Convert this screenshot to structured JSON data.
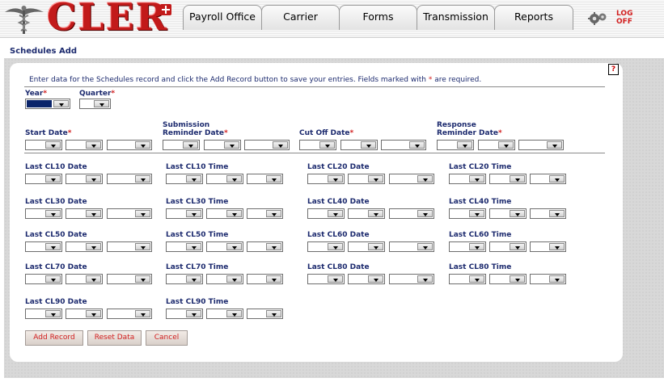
{
  "header": {
    "logo_text": "CLER",
    "tabs": [
      "Payroll Office",
      "Carrier",
      "Forms",
      "Transmission",
      "Reports"
    ],
    "logoff_line1": "LOG",
    "logoff_line2": "OFF"
  },
  "page_title": "Schedules Add",
  "help_label": "?",
  "instructions": {
    "text_before": "Enter data for the Schedules record and click the Add Record button to save your entries.  Fields marked with ",
    "required_mark": "*",
    "text_after": " are required."
  },
  "fields": {
    "year": "Year",
    "quarter": "Quarter",
    "start_date": "Start Date",
    "submission_reminder_line1": "Submission",
    "submission_reminder_line2": "Reminder Date",
    "cut_off_date": "Cut Off Date",
    "response_reminder_line1": "Response",
    "response_reminder_line2": "Reminder Date"
  },
  "cl_rows": [
    [
      "Last CL10 Date",
      "Last CL10 Time",
      "Last CL20 Date",
      "Last CL20 Time"
    ],
    [
      "Last CL30 Date",
      "Last CL30 Time",
      "Last CL40 Date",
      "Last CL40 Time"
    ],
    [
      "Last CL50 Date",
      "Last CL50 Time",
      "Last CL60 Date",
      "Last CL60 Time"
    ],
    [
      "Last CL70 Date",
      "Last CL70 Time",
      "Last CL80 Date",
      "Last CL80 Time"
    ],
    [
      "Last CL90 Date",
      "Last CL90 Time"
    ]
  ],
  "buttons": {
    "add_record": "Add Record",
    "reset_data": "Reset Data",
    "cancel": "Cancel"
  },
  "colors": {
    "brand_red": "#c21a1a",
    "label_navy": "#1c2a6e",
    "required_red": "#d21e1e"
  }
}
